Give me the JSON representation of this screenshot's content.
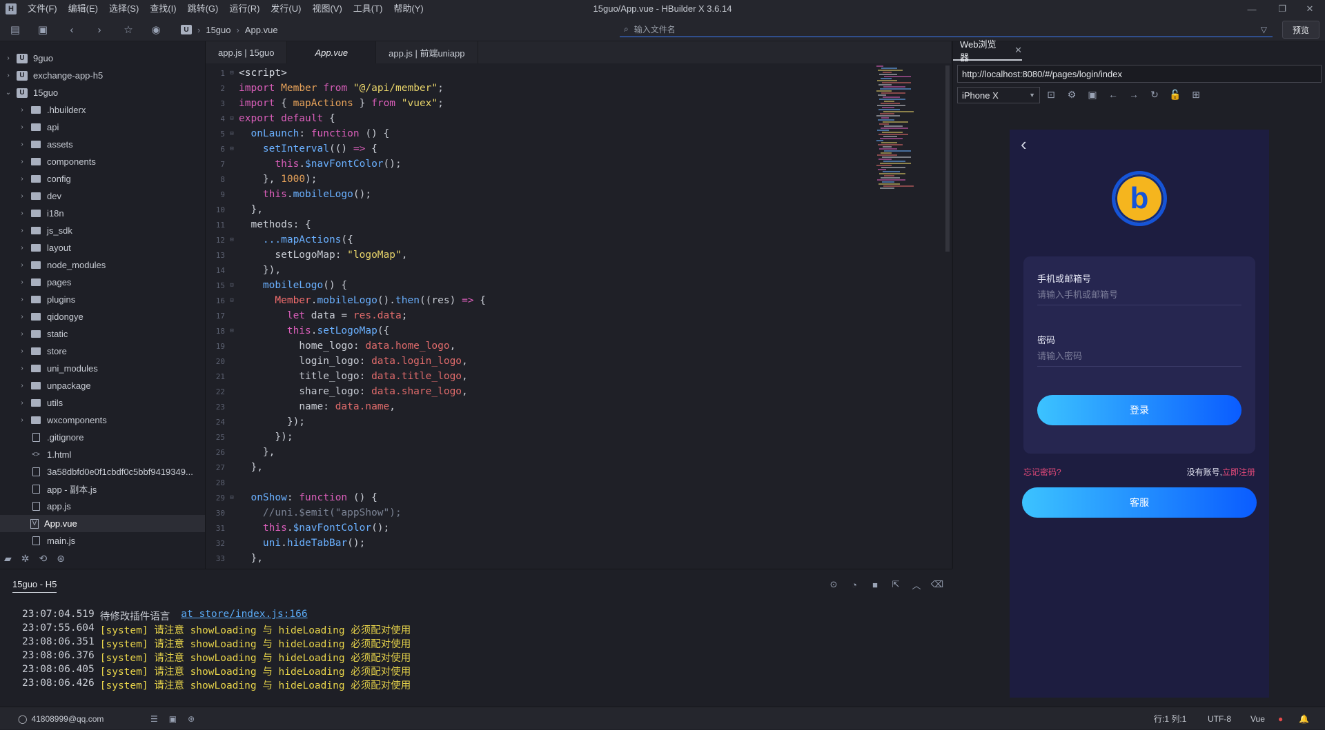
{
  "window": {
    "title": "15guo/App.vue - HBuilder X 3.6.14",
    "menu": [
      "文件(F)",
      "编辑(E)",
      "选择(S)",
      "查找(I)",
      "跳转(G)",
      "运行(R)",
      "发行(U)",
      "视图(V)",
      "工具(T)",
      "帮助(Y)"
    ]
  },
  "toolbar": {
    "breadcrumb": [
      "15guo",
      "App.vue"
    ],
    "search_placeholder": "输入文件名",
    "preview_label": "预览"
  },
  "sidebar": {
    "items": [
      {
        "label": "9guo",
        "type": "project",
        "expanded": false
      },
      {
        "label": "exchange-app-h5",
        "type": "project",
        "expanded": false
      },
      {
        "label": "15guo",
        "type": "project",
        "expanded": true
      },
      {
        "label": ".hbuilderx",
        "type": "folder"
      },
      {
        "label": "api",
        "type": "folder"
      },
      {
        "label": "assets",
        "type": "folder"
      },
      {
        "label": "components",
        "type": "folder"
      },
      {
        "label": "config",
        "type": "folder"
      },
      {
        "label": "dev",
        "type": "folder"
      },
      {
        "label": "i18n",
        "type": "folder"
      },
      {
        "label": "js_sdk",
        "type": "folder"
      },
      {
        "label": "layout",
        "type": "folder"
      },
      {
        "label": "node_modules",
        "type": "folder"
      },
      {
        "label": "pages",
        "type": "folder"
      },
      {
        "label": "plugins",
        "type": "folder"
      },
      {
        "label": "qidongye",
        "type": "folder"
      },
      {
        "label": "static",
        "type": "folder"
      },
      {
        "label": "store",
        "type": "folder"
      },
      {
        "label": "uni_modules",
        "type": "folder"
      },
      {
        "label": "unpackage",
        "type": "folder"
      },
      {
        "label": "utils",
        "type": "folder"
      },
      {
        "label": "wxcomponents",
        "type": "folder"
      },
      {
        "label": ".gitignore",
        "type": "file"
      },
      {
        "label": "1.html",
        "type": "html"
      },
      {
        "label": "3a58dbfd0e0f1cbdf0c5bbf9419349...",
        "type": "file"
      },
      {
        "label": "app - 副本.js",
        "type": "file"
      },
      {
        "label": "app.js",
        "type": "file"
      },
      {
        "label": "App.vue",
        "type": "vue",
        "active": true
      },
      {
        "label": "main.js",
        "type": "file"
      }
    ]
  },
  "editor": {
    "tabs": [
      {
        "label": "app.js | 15guo",
        "active": false
      },
      {
        "label": "App.vue",
        "active": true
      },
      {
        "label": "app.js | 前端uniapp",
        "active": false
      }
    ]
  },
  "browser": {
    "tab_label": "Web浏览器",
    "url": "http://localhost:8080/#/pages/login/index",
    "device": "iPhone X",
    "phone": {
      "account_label": "手机或邮箱号",
      "account_placeholder": "请输入手机或邮箱号",
      "password_label": "密码",
      "password_placeholder": "请输入密码",
      "login_button": "登录",
      "forgot_link": "忘记密码?",
      "no_account_text": "没有账号,",
      "register_link": "立即注册",
      "service_button": "客服"
    }
  },
  "console": {
    "tab_label": "15guo - H5",
    "logs": [
      {
        "time": "23:07:04.519",
        "message": "待修改插件语言",
        "link": "at store/index.js:166",
        "style": "plain"
      },
      {
        "time": "23:07:55.604",
        "message": "[system] 请注意 showLoading 与 hideLoading 必须配对使用",
        "style": "warn"
      },
      {
        "time": "23:08:06.351",
        "message": "[system] 请注意 showLoading 与 hideLoading 必须配对使用",
        "style": "warn"
      },
      {
        "time": "23:08:06.376",
        "message": "[system] 请注意 showLoading 与 hideLoading 必须配对使用",
        "style": "warn"
      },
      {
        "time": "23:08:06.405",
        "message": "[system] 请注意 showLoading 与 hideLoading 必须配对使用",
        "style": "warn"
      },
      {
        "time": "23:08:06.426",
        "message": "[system] 请注意 showLoading 与 hideLoading 必须配对使用",
        "style": "warn"
      }
    ]
  },
  "statusbar": {
    "user": "41808999@qq.com",
    "cursor": "行:1  列:1",
    "encoding": "UTF-8",
    "language": "Vue"
  },
  "colors": {
    "accent": "#3d7eff",
    "button_gradient_start": "#3cc3ff",
    "button_gradient_end": "#0a5cff",
    "link_pink": "#e64a7a",
    "warn_yellow": "#e8d44a"
  }
}
